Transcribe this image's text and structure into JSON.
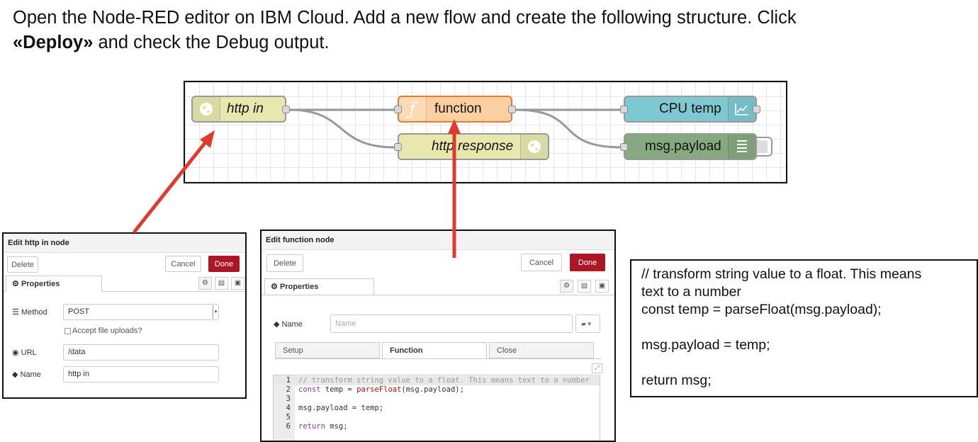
{
  "instructions": {
    "part1": "Open the Node-RED editor on IBM Cloud. Add a new flow and create the following structure. Click",
    "deploy": "«Deploy»",
    "part2": "and check the Debug output."
  },
  "flow": {
    "nodes": {
      "http_in": {
        "label": "http in",
        "icon": "globe-icon"
      },
      "function": {
        "label": "function",
        "icon": "function-icon"
      },
      "http_response": {
        "label": "http response",
        "icon": "globe-icon"
      },
      "cpu_temp": {
        "label": "CPU temp",
        "icon": "chart-icon"
      },
      "debug": {
        "label": "msg.payload",
        "icon": "list-icon"
      }
    }
  },
  "http_dialog": {
    "title": "Edit http in node",
    "delete": "Delete",
    "cancel": "Cancel",
    "done": "Done",
    "tab": "Properties",
    "method_label": "Method",
    "method_value": "POST",
    "accept_uploads": "Accept file uploads?",
    "url_label": "URL",
    "url_value": "/data",
    "name_label": "Name",
    "name_value": "http in"
  },
  "function_dialog": {
    "title": "Edit function node",
    "delete": "Delete",
    "cancel": "Cancel",
    "done": "Done",
    "tab": "Properties",
    "name_label": "Name",
    "name_placeholder": "Name",
    "subtabs": [
      "Setup",
      "Function",
      "Close"
    ],
    "code_lines": [
      {
        "n": "1",
        "text": "// transform string value to a float. This means text to a number"
      },
      {
        "n": "2",
        "text": "const temp = parseFloat(msg.payload);"
      },
      {
        "n": "3",
        "text": ""
      },
      {
        "n": "4",
        "text": "msg.payload = temp;"
      },
      {
        "n": "5",
        "text": ""
      },
      {
        "n": "6",
        "text": "return msg;"
      }
    ]
  },
  "code_box": {
    "lines": [
      "// transform string value to a float. This means",
      "text to a number",
      "const temp = parseFloat(msg.payload);",
      "",
      "msg.payload = temp;",
      "",
      "return msg;"
    ]
  },
  "colors": {
    "arrow": "#e03a2c",
    "done_button": "#ad1625",
    "function_node": "#fdd0a2",
    "http_node": "#e7e7ae",
    "chart_node": "#7ec8d1",
    "debug_node": "#87a980"
  }
}
